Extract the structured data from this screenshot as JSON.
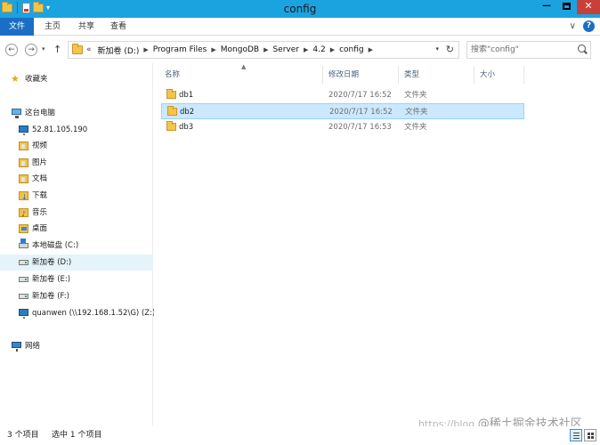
{
  "window": {
    "title": "config",
    "minimize_icon": "minimize-icon",
    "maximize_icon": "maximize-icon",
    "close_icon": "close-icon"
  },
  "ribbon": {
    "tabs": [
      "文件",
      "主页",
      "共享",
      "查看"
    ]
  },
  "address": {
    "overflow": "«",
    "crumbs": [
      "新加卷 (D:)",
      "Program Files",
      "MongoDB",
      "Server",
      "4.2",
      "config"
    ]
  },
  "search": {
    "placeholder": "搜索\"config\""
  },
  "nav": {
    "favorites": "收藏夹",
    "this_pc": "这台电脑",
    "items": [
      "52.81.105.190",
      "视频",
      "图片",
      "文档",
      "下载",
      "音乐",
      "桌面",
      "本地磁盘 (C:)",
      "新加卷 (D:)",
      "新加卷 (E:)",
      "新加卷 (F:)",
      "quanwen (\\\\192.168.1.52\\G) (Z:)"
    ],
    "network": "网络"
  },
  "columns": {
    "name": "名称",
    "modified": "修改日期",
    "type": "类型",
    "size": "大小"
  },
  "files": [
    {
      "name": "db1",
      "modified": "2020/7/17 16:52",
      "type": "文件夹"
    },
    {
      "name": "db2",
      "modified": "2020/7/17 16:52",
      "type": "文件夹"
    },
    {
      "name": "db3",
      "modified": "2020/7/17 16:53",
      "type": "文件夹"
    }
  ],
  "status": {
    "count": "3 个项目",
    "selected": "选中 1 个项目"
  },
  "watermark": {
    "prefix": "https://blog.",
    "text": "@稀土掘金技术社区"
  }
}
